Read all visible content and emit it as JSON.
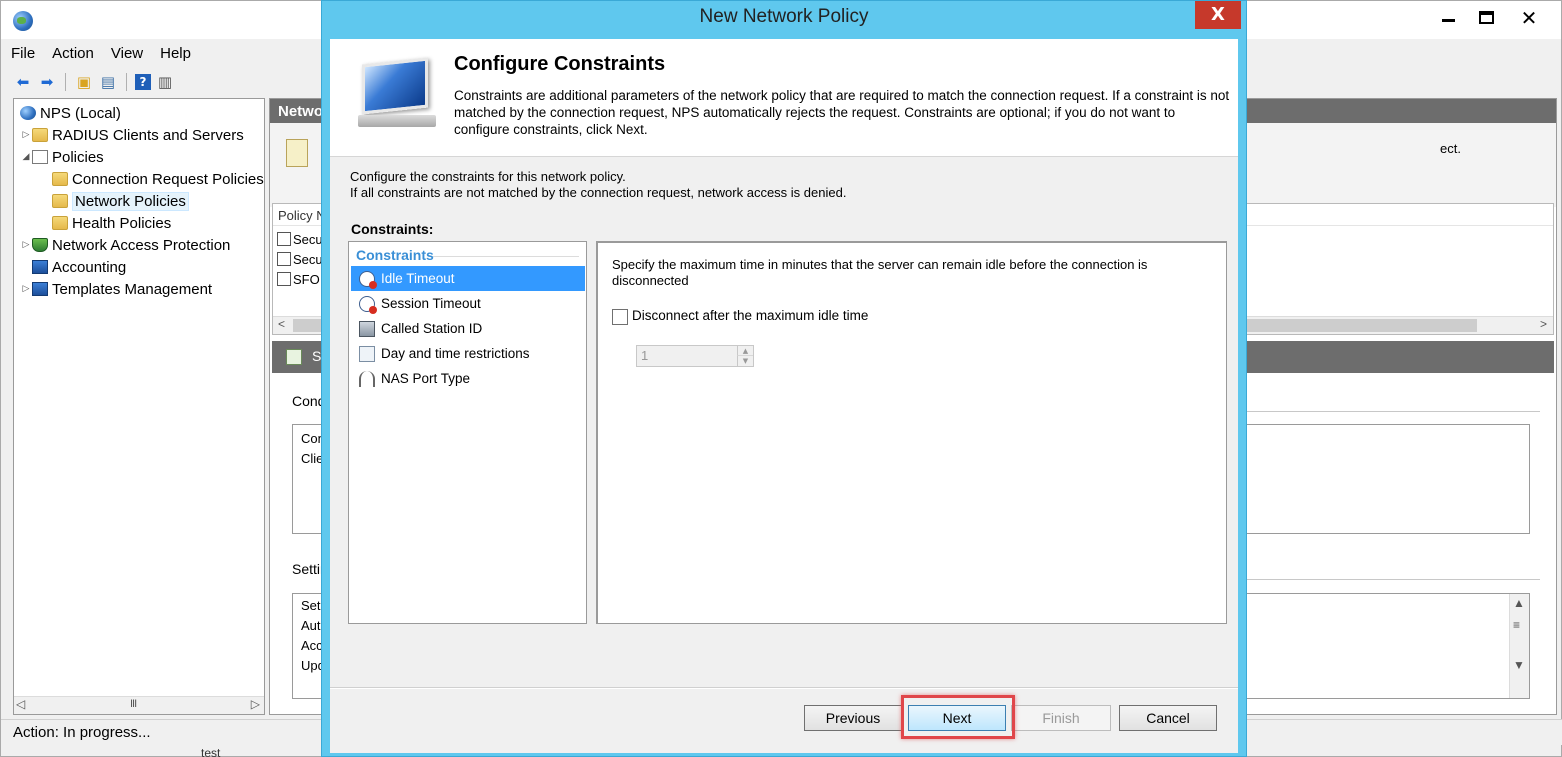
{
  "mmc": {
    "menu": [
      "File",
      "Action",
      "View",
      "Help"
    ],
    "tree": {
      "root": "NPS (Local)",
      "items": [
        {
          "label": "RADIUS Clients and Servers"
        },
        {
          "label": "Policies"
        },
        {
          "label": "Connection Request Policies"
        },
        {
          "label": "Network Policies"
        },
        {
          "label": "Health Policies"
        },
        {
          "label": "Network Access Protection"
        },
        {
          "label": "Accounting"
        },
        {
          "label": "Templates Management"
        }
      ]
    },
    "pane_title": "Netwo",
    "pane_desc_tail": "ect.",
    "list_header": "Policy N",
    "list_rows": [
      "Secu",
      "Secu",
      "SFO"
    ],
    "detail_head": "S",
    "group1_label": "Cond",
    "group1_rows": [
      "Con",
      "Clie"
    ],
    "group2_label": "Settin",
    "group2_rows": [
      "Set",
      "Aut",
      "Acc",
      "Upd"
    ],
    "status": "Action:  In progress...",
    "taskbar_peek": "test"
  },
  "dialog": {
    "title": "New Network Policy",
    "close_glyph": "X",
    "banner": {
      "title": "Configure Constraints",
      "text": "Constraints are additional parameters of the network policy that are required to match the connection request. If a constraint is not matched by the connection request, NPS automatically rejects the request. Constraints are optional; if you do not want to configure constraints, click Next."
    },
    "intro_line1": "Configure the constraints for this network policy.",
    "intro_line2": "If all constraints are not matched by the connection request, network access is denied.",
    "constraints_label": "Constraints:",
    "list_heading": "Constraints",
    "constraints": [
      {
        "label": "Idle Timeout",
        "icon": "clock-icon",
        "selected": true
      },
      {
        "label": "Session Timeout",
        "icon": "clock-icon",
        "selected": false
      },
      {
        "label": "Called Station ID",
        "icon": "phone-icon",
        "selected": false
      },
      {
        "label": "Day and time restrictions",
        "icon": "calendar-clock-icon",
        "selected": false
      },
      {
        "label": "NAS Port Type",
        "icon": "antenna-icon",
        "selected": false
      }
    ],
    "panel": {
      "description": "Specify the maximum time in minutes that the server can remain idle before the connection is disconnected",
      "checkbox_label": "Disconnect after the maximum idle time",
      "checkbox_checked": false,
      "spinner_value": "1"
    },
    "buttons": {
      "previous": "Previous",
      "next": "Next",
      "finish": "Finish",
      "cancel": "Cancel"
    }
  },
  "colors": {
    "dialog_frame": "#5fc8ee",
    "selection": "#3399ff",
    "close_button": "#c6392b",
    "highlight": "#e0464a",
    "list_heading": "#3a8fd6"
  }
}
